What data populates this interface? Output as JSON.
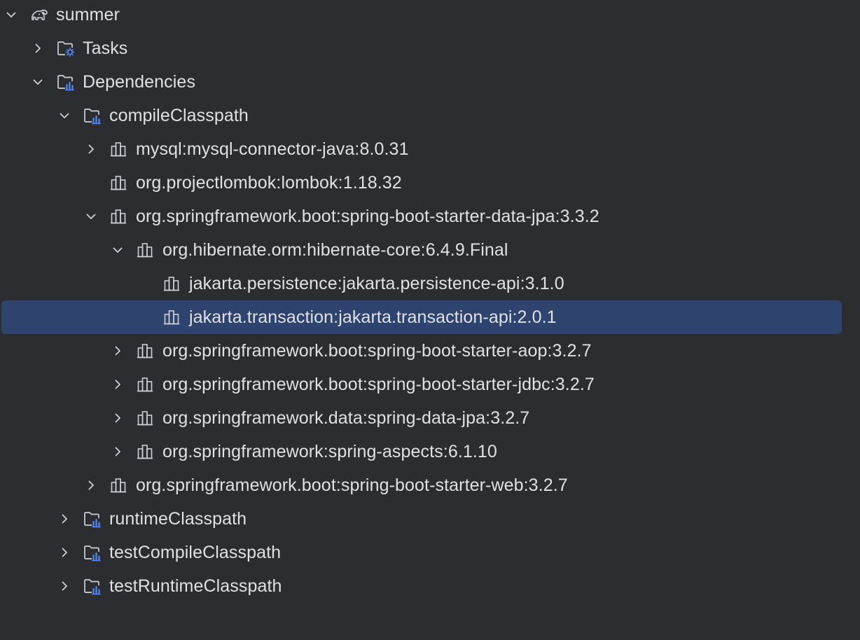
{
  "tree": {
    "rows": [
      {
        "label": "summer",
        "icon": "gradle-elephant-icon",
        "toggle": "expanded"
      },
      {
        "label": "Tasks",
        "icon": "tasks-folder-icon",
        "toggle": "collapsed"
      },
      {
        "label": "Dependencies",
        "icon": "dependencies-folder-icon",
        "toggle": "expanded"
      },
      {
        "label": "compileClasspath",
        "icon": "dependencies-folder-icon",
        "toggle": "expanded"
      },
      {
        "label": "mysql:mysql-connector-java:8.0.31",
        "icon": "library-icon",
        "toggle": "collapsed"
      },
      {
        "label": "org.projectlombok:lombok:1.18.32",
        "icon": "library-icon",
        "toggle": "none"
      },
      {
        "label": "org.springframework.boot:spring-boot-starter-data-jpa:3.3.2",
        "icon": "library-icon",
        "toggle": "expanded"
      },
      {
        "label": "org.hibernate.orm:hibernate-core:6.4.9.Final",
        "icon": "library-icon",
        "toggle": "expanded"
      },
      {
        "label": "jakarta.persistence:jakarta.persistence-api:3.1.0",
        "icon": "library-icon",
        "toggle": "none"
      },
      {
        "label": "jakarta.transaction:jakarta.transaction-api:2.0.1",
        "icon": "library-icon",
        "toggle": "none",
        "selected": true
      },
      {
        "label": "org.springframework.boot:spring-boot-starter-aop:3.2.7",
        "icon": "library-icon",
        "toggle": "collapsed"
      },
      {
        "label": "org.springframework.boot:spring-boot-starter-jdbc:3.2.7",
        "icon": "library-icon",
        "toggle": "collapsed"
      },
      {
        "label": "org.springframework.data:spring-data-jpa:3.2.7",
        "icon": "library-icon",
        "toggle": "collapsed"
      },
      {
        "label": "org.springframework:spring-aspects:6.1.10",
        "icon": "library-icon",
        "toggle": "collapsed"
      },
      {
        "label": "org.springframework.boot:spring-boot-starter-web:3.2.7",
        "icon": "library-icon",
        "toggle": "collapsed"
      },
      {
        "label": "runtimeClasspath",
        "icon": "dependencies-folder-icon",
        "toggle": "collapsed"
      },
      {
        "label": "testCompileClasspath",
        "icon": "dependencies-folder-icon",
        "toggle": "collapsed"
      },
      {
        "label": "testRuntimeClasspath",
        "icon": "dependencies-folder-icon",
        "toggle": "collapsed"
      }
    ]
  },
  "colors": {
    "background": "#2b2d30",
    "selection": "#2e436e",
    "text": "#dfe1e5",
    "icon": "#ced0d6",
    "accent_blue": "#548af7"
  }
}
